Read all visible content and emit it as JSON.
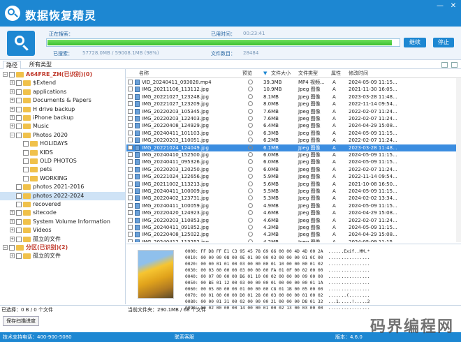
{
  "app": {
    "title": "数据恢复精灵",
    "colors": {
      "primary": "#1d87d2",
      "progress": "#3bbf2f",
      "selected_row": "#3b8de0"
    }
  },
  "window": {
    "minimize": "—",
    "close": "✕"
  },
  "scan": {
    "scanning_label": "正在搜索：",
    "scanning_value": "",
    "elapsed_label": "已用时间：",
    "elapsed_value": "00:23:41",
    "searched_label": "已搜索：",
    "searched_value": "57728.0MB / 59008.1MB (98%)",
    "files_label": "文件数目：",
    "files_value": "28484",
    "progress_percent": 98,
    "continue_btn": "继续",
    "stop_btn": "停止"
  },
  "tabs": {
    "path": "路径",
    "types": "所有类型"
  },
  "tree": [
    {
      "label": "A64FRE_ZH(已识别)(0)",
      "level": 0,
      "expander": "−",
      "red": true
    },
    {
      "label": "$Extend",
      "level": 1,
      "expander": "+"
    },
    {
      "label": "applications",
      "level": 1,
      "expander": "+"
    },
    {
      "label": "Documents & Papers",
      "level": 1,
      "expander": "+"
    },
    {
      "label": "H drive backup",
      "level": 1,
      "expander": "+"
    },
    {
      "label": "iPhone backup",
      "level": 1,
      "expander": "+"
    },
    {
      "label": "Music",
      "level": 1,
      "expander": "+"
    },
    {
      "label": "Photos 2020",
      "level": 1,
      "expander": "−"
    },
    {
      "label": "HOLIDAYS",
      "level": 2,
      "expander": ""
    },
    {
      "label": "KIDS",
      "level": 2,
      "expander": ""
    },
    {
      "label": "OLD PHOTOS",
      "level": 2,
      "expander": ""
    },
    {
      "label": "pets",
      "level": 2,
      "expander": ""
    },
    {
      "label": "WORKING",
      "level": 2,
      "expander": ""
    },
    {
      "label": "photos 2021-2016",
      "level": 1,
      "expander": ""
    },
    {
      "label": "photos 2022-2024",
      "level": 1,
      "expander": "",
      "selected": true
    },
    {
      "label": "recovered",
      "level": 1,
      "expander": ""
    },
    {
      "label": "sitecode",
      "level": 1,
      "expander": "+"
    },
    {
      "label": "System Volume Information",
      "level": 1,
      "expander": "+"
    },
    {
      "label": "Videos",
      "level": 1,
      "expander": "+"
    },
    {
      "label": "孤立的文件",
      "level": 1,
      "expander": "+"
    },
    {
      "label": "分区(已识别)(2)",
      "level": 0,
      "expander": "−",
      "red": true
    },
    {
      "label": "孤立的文件",
      "level": 1,
      "expander": "+"
    }
  ],
  "list": {
    "headers": {
      "name": "名称",
      "preview": "预览",
      "size": "文件大小",
      "type": "文件类型",
      "attr": "属性",
      "modified": "修改时间"
    },
    "rows": [
      {
        "name": "VID_20240411_093028.mp4",
        "size": "39.3MB",
        "type": "MP4 视频...",
        "attr": "A",
        "date": "2024-05-09 11:15..."
      },
      {
        "name": "IMG_20211106_113112.jpg",
        "size": "10.9MB",
        "type": "Jpeg 图像",
        "attr": "A",
        "date": "2021-11-30 16:05..."
      },
      {
        "name": "IMG_20221027_123248.jpg",
        "size": "8.1MB",
        "type": "Jpeg 图像",
        "attr": "A",
        "date": "2023-03-28 11:48..."
      },
      {
        "name": "IMG_20221027_123209.jpg",
        "size": "8.0MB",
        "type": "Jpeg 图像",
        "attr": "A",
        "date": "2022-11-14 09:54..."
      },
      {
        "name": "IMG_20220203_105345.jpg",
        "size": "7.6MB",
        "type": "Jpeg 图像",
        "attr": "A",
        "date": "2022-02-07 11:24..."
      },
      {
        "name": "IMG_20220203_122403.jpg",
        "size": "7.6MB",
        "type": "Jpeg 图像",
        "attr": "A",
        "date": "2022-02-07 11:24..."
      },
      {
        "name": "IMG_20220408_124929.jpg",
        "size": "6.4MB",
        "type": "Jpeg 图像",
        "attr": "A",
        "date": "2024-04-29 15:08..."
      },
      {
        "name": "IMG_20240411_101103.jpg",
        "size": "6.3MB",
        "type": "Jpeg 图像",
        "attr": "A",
        "date": "2024-05-09 11:15..."
      },
      {
        "name": "IMG_20220203_110051.jpg",
        "size": "6.2MB",
        "type": "Jpeg 图像",
        "attr": "A",
        "date": "2022-02-07 11:24..."
      },
      {
        "name": "IMG_20221024_124049.jpg",
        "size": "6.1MB",
        "type": "Jpeg 图像",
        "attr": "A",
        "date": "2023-03-28 11:48...",
        "selected": true
      },
      {
        "name": "IMG_20240410_152500.jpg",
        "size": "6.0MB",
        "type": "Jpeg 图像",
        "attr": "A",
        "date": "2024-05-09 11:15..."
      },
      {
        "name": "IMG_20240411_095326.jpg",
        "size": "6.0MB",
        "type": "Jpeg 图像",
        "attr": "A",
        "date": "2024-05-09 11:15..."
      },
      {
        "name": "IMG_20220203_120250.jpg",
        "size": "6.0MB",
        "type": "Jpeg 图像",
        "attr": "A",
        "date": "2022-02-07 11:24..."
      },
      {
        "name": "IMG_20221024_122656.jpg",
        "size": "5.9MB",
        "type": "Jpeg 图像",
        "attr": "A",
        "date": "2022-11-14 09:54..."
      },
      {
        "name": "IMG_20211002_113213.jpg",
        "size": "5.6MB",
        "type": "Jpeg 图像",
        "attr": "A",
        "date": "2021-10-08 16:50..."
      },
      {
        "name": "IMG_20240411_100009.jpg",
        "size": "5.5MB",
        "type": "Jpeg 图像",
        "attr": "A",
        "date": "2024-05-09 11:15..."
      },
      {
        "name": "IMG_20220402_123731.jpg",
        "size": "5.3MB",
        "type": "Jpeg 图像",
        "attr": "A",
        "date": "2024-02-02 13:34..."
      },
      {
        "name": "IMG_20240411_100059.jpg",
        "size": "4.9MB",
        "type": "Jpeg 图像",
        "attr": "A",
        "date": "2024-05-09 11:15..."
      },
      {
        "name": "IMG_20220420_124923.jpg",
        "size": "4.6MB",
        "type": "Jpeg 图像",
        "attr": "A",
        "date": "2024-04-29 15:08..."
      },
      {
        "name": "IMG_20220203_110853.jpg",
        "size": "4.6MB",
        "type": "Jpeg 图像",
        "attr": "A",
        "date": "2022-02-07 11:24..."
      },
      {
        "name": "IMG_20240411_091852.jpg",
        "size": "4.3MB",
        "type": "Jpeg 图像",
        "attr": "A",
        "date": "2024-05-09 11:15..."
      },
      {
        "name": "IMG_20220408_125022.jpg",
        "size": "4.3MB",
        "type": "Jpeg 图像",
        "attr": "A",
        "date": "2024-04-29 15:08..."
      },
      {
        "name": "IMG_20240412_113252.jpg",
        "size": "4.2MB",
        "type": "Jpeg 图像",
        "attr": "A",
        "date": "2024-05-09 11:15..."
      }
    ]
  },
  "hex": [
    "0000: FF D8 FF E1 C3 95 45 78 69 66 00 00 4D 4D 00 2A  ......Exif..MM.*",
    "0010: 00 00 00 08 00 0E 01 00 00 03 00 00 00 01 0C 00  ................",
    "0020: 00 00 01 01 00 03 00 00 00 01 10 00 00 00 01 02  ................",
    "0030: 00 03 00 00 00 03 00 00 00 FA 01 0F 00 02 00 00  ................",
    "0040: 00 07 00 00 00 B6 01 10 00 02 00 00 00 09 00 00  ................",
    "0050: 00 BE 01 12 00 03 00 00 00 01 00 00 00 00 01 1A  ................",
    "0060: 00 05 00 00 00 01 00 00 00 C8 01 1B 00 05 00 00  ................",
    "0070: 00 01 00 00 00 D0 01 28 00 03 00 00 00 01 00 02  .......(........",
    "0080: 00 00 01 31 00 02 00 00 00 21 00 00 00 D8 01 32  ...1.....!.....2",
    "0090: 00 02 00 00 00 14 00 00 01 00 02 13 00 03 00 00  ................"
  ],
  "status": {
    "selected": "已选择：0 B / 0 个文件",
    "current": "当前文件夹：290.1MB / 68 个文件"
  },
  "buttons": {
    "save_scan": "保存扫描进度"
  },
  "footer": {
    "support": "技术支持电话：400-900-5080",
    "service": "联系客服",
    "version": "版本：4.6.0"
  },
  "watermark": "码界编程网"
}
